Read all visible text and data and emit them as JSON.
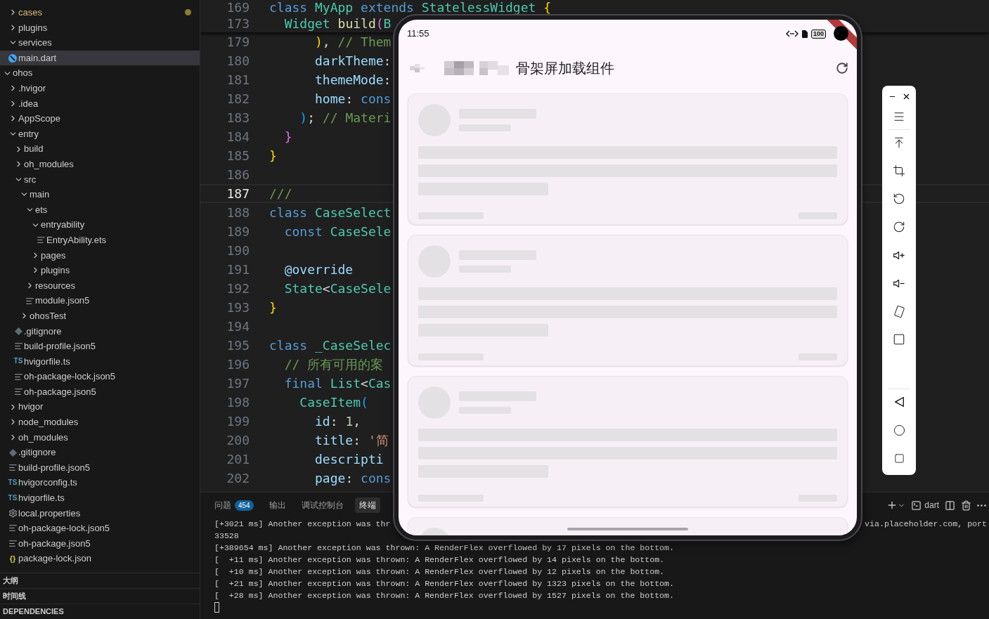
{
  "explorer": {
    "nested_items": [
      {
        "name": "cases",
        "kind": "folder",
        "expanded": false,
        "selected": false,
        "modified": true
      },
      {
        "name": "plugins",
        "kind": "folder",
        "expanded": false,
        "selected": false,
        "modified": false
      },
      {
        "name": "services",
        "kind": "folder",
        "expanded": true,
        "selected": false,
        "modified": false
      },
      {
        "name": "main.dart",
        "kind": "dart",
        "selected": true,
        "modified": false
      }
    ],
    "items": [
      {
        "name": "ohos",
        "kind": "folder",
        "expanded": true,
        "selected": false,
        "modified": false,
        "children": [
          {
            "name": ".hvigor",
            "kind": "folder",
            "expanded": false,
            "selected": false,
            "modified": false
          },
          {
            "name": ".idea",
            "kind": "folder",
            "expanded": false,
            "selected": false,
            "modified": false
          },
          {
            "name": "AppScope",
            "kind": "folder",
            "expanded": false,
            "selected": false,
            "modified": false
          },
          {
            "name": "entry",
            "kind": "folder",
            "expanded": true,
            "selected": false,
            "modified": false,
            "children": [
              {
                "name": "build",
                "kind": "folder",
                "expanded": false,
                "selected": false,
                "modified": false
              },
              {
                "name": "oh_modules",
                "kind": "folder",
                "expanded": false,
                "selected": false,
                "modified": false
              },
              {
                "name": "src",
                "kind": "folder",
                "expanded": true,
                "selected": false,
                "modified": false,
                "children": [
                  {
                    "name": "main",
                    "kind": "folder",
                    "expanded": true,
                    "selected": false,
                    "modified": false,
                    "children": [
                      {
                        "name": "ets",
                        "kind": "folder",
                        "expanded": true,
                        "selected": false,
                        "modified": false,
                        "children": [
                          {
                            "name": "entryability",
                            "kind": "folder",
                            "expanded": true,
                            "selected": false,
                            "modified": false,
                            "children": [
                              {
                                "name": "EntryAbility.ets",
                                "kind": "text",
                                "selected": false,
                                "modified": false
                              }
                            ]
                          },
                          {
                            "name": "pages",
                            "kind": "folder",
                            "expanded": false,
                            "selected": false,
                            "modified": false
                          },
                          {
                            "name": "plugins",
                            "kind": "folder",
                            "expanded": false,
                            "selected": false,
                            "modified": false
                          }
                        ]
                      },
                      {
                        "name": "resources",
                        "kind": "folder",
                        "expanded": false,
                        "selected": false,
                        "modified": false
                      },
                      {
                        "name": "module.json5",
                        "kind": "text",
                        "selected": false,
                        "modified": false
                      }
                    ]
                  },
                  {
                    "name": "ohosTest",
                    "kind": "folder",
                    "expanded": false,
                    "selected": false,
                    "modified": false
                  }
                ]
              },
              {
                "name": ".gitignore",
                "kind": "git",
                "selected": false,
                "modified": false
              },
              {
                "name": "build-profile.json5",
                "kind": "text",
                "selected": false,
                "modified": false
              },
              {
                "name": "hvigorfile.ts",
                "kind": "ts",
                "icon_text": "TS",
                "selected": false,
                "modified": false
              },
              {
                "name": "oh-package-lock.json5",
                "kind": "text",
                "selected": false,
                "modified": false
              },
              {
                "name": "oh-package.json5",
                "kind": "text",
                "selected": false,
                "modified": false
              }
            ]
          },
          {
            "name": "hvigor",
            "kind": "folder",
            "expanded": false,
            "selected": false,
            "modified": false
          },
          {
            "name": "node_modules",
            "kind": "folder",
            "expanded": false,
            "selected": false,
            "modified": false
          },
          {
            "name": "oh_modules",
            "kind": "folder",
            "expanded": false,
            "selected": false,
            "modified": false
          },
          {
            "name": ".gitignore",
            "kind": "git",
            "selected": false,
            "modified": false
          },
          {
            "name": "build-profile.json5",
            "kind": "text",
            "selected": false,
            "modified": false
          },
          {
            "name": "hvigorconfig.ts",
            "kind": "ts",
            "icon_text": "TS",
            "selected": false,
            "modified": false
          },
          {
            "name": "hvigorfile.ts",
            "kind": "ts",
            "icon_text": "TS",
            "selected": false,
            "modified": false
          },
          {
            "name": "local.properties",
            "kind": "gear",
            "selected": false,
            "modified": false
          },
          {
            "name": "oh-package-lock.json5",
            "kind": "text",
            "selected": false,
            "modified": false
          },
          {
            "name": "oh-package.json5",
            "kind": "text",
            "selected": false,
            "modified": false
          },
          {
            "name": "package-lock.json",
            "kind": "braces",
            "icon_text": "{}",
            "selected": false,
            "modified": false
          }
        ]
      }
    ]
  },
  "sections": [
    {
      "label": "大纲"
    },
    {
      "label": "时间线"
    },
    {
      "label": "DEPENDENCIES"
    }
  ],
  "editor": {
    "sticky_lines": [
      {
        "number": "169",
        "current": false,
        "tokens": [
          {
            "t": "class",
            "kind": "keyword"
          },
          {
            "t": " MyApp",
            "kind": "type"
          },
          {
            "t": " extends",
            "kind": "keyword"
          },
          {
            "t": " StatelessWidget",
            "kind": "type"
          },
          {
            "t": " {",
            "kind": "bracket1"
          }
        ]
      },
      {
        "number": "173",
        "current": false,
        "tokens": [
          {
            "t": "  Widget",
            "kind": "type"
          },
          {
            "t": " build",
            "kind": "function"
          },
          {
            "t": "(",
            "kind": "bracket2"
          },
          {
            "t": "B",
            "kind": "type"
          }
        ]
      }
    ],
    "lines": [
      {
        "number": "179",
        "current": false,
        "tokens": [
          {
            "t": "      )",
            "kind": "bracket1"
          },
          {
            "t": ", ",
            "kind": "plain"
          },
          {
            "t": "// Them",
            "kind": "comment"
          }
        ]
      },
      {
        "number": "180",
        "current": false,
        "tokens": [
          {
            "t": "      darkTheme",
            "kind": "variable"
          },
          {
            "t": ":",
            "kind": "plain"
          }
        ]
      },
      {
        "number": "181",
        "current": false,
        "tokens": [
          {
            "t": "      themeMode",
            "kind": "variable"
          },
          {
            "t": ":",
            "kind": "plain"
          }
        ]
      },
      {
        "number": "182",
        "current": false,
        "tokens": [
          {
            "t": "      home",
            "kind": "variable"
          },
          {
            "t": ": ",
            "kind": "plain"
          },
          {
            "t": "cons",
            "kind": "keyword"
          }
        ]
      },
      {
        "number": "183",
        "current": false,
        "tokens": [
          {
            "t": "    )",
            "kind": "bracket3"
          },
          {
            "t": "; ",
            "kind": "plain"
          },
          {
            "t": "// Materi",
            "kind": "comment"
          }
        ]
      },
      {
        "number": "184",
        "current": false,
        "tokens": [
          {
            "t": "  }",
            "kind": "bracket2"
          }
        ]
      },
      {
        "number": "185",
        "current": false,
        "tokens": [
          {
            "t": "}",
            "kind": "bracket1"
          }
        ]
      },
      {
        "number": "186",
        "current": false
      },
      {
        "number": "187",
        "current": true,
        "tokens": [
          {
            "t": "///",
            "kind": "comment"
          }
        ]
      },
      {
        "number": "188",
        "current": false,
        "tokens": [
          {
            "t": "class",
            "kind": "keyword"
          },
          {
            "t": " CaseSelect",
            "kind": "type"
          }
        ]
      },
      {
        "number": "189",
        "current": false,
        "tokens": [
          {
            "t": "  const",
            "kind": "keyword"
          },
          {
            "t": " CaseSele",
            "kind": "type"
          }
        ]
      },
      {
        "number": "190",
        "current": false
      },
      {
        "number": "191",
        "current": false,
        "tokens": [
          {
            "t": "  @override",
            "kind": "variable"
          }
        ]
      },
      {
        "number": "192",
        "current": false,
        "tokens": [
          {
            "t": "  State",
            "kind": "type"
          },
          {
            "t": "<",
            "kind": "plain"
          },
          {
            "t": "CaseSele",
            "kind": "type"
          }
        ]
      },
      {
        "number": "193",
        "current": false,
        "tokens": [
          {
            "t": "}",
            "kind": "bracket1"
          }
        ]
      },
      {
        "number": "194",
        "current": false
      },
      {
        "number": "195",
        "current": false,
        "tokens": [
          {
            "t": "class",
            "kind": "keyword"
          },
          {
            "t": " _CaseSelec",
            "kind": "type"
          }
        ]
      },
      {
        "number": "196",
        "current": false,
        "tokens": [
          {
            "t": "  // 所有可用的案",
            "kind": "comment"
          }
        ]
      },
      {
        "number": "197",
        "current": false,
        "tokens": [
          {
            "t": "  final",
            "kind": "keyword"
          },
          {
            "t": " List",
            "kind": "type"
          },
          {
            "t": "<",
            "kind": "plain"
          },
          {
            "t": "Cas",
            "kind": "type"
          }
        ]
      },
      {
        "number": "198",
        "current": false,
        "tokens": [
          {
            "t": "    CaseItem",
            "kind": "type"
          },
          {
            "t": "(",
            "kind": "bracket3"
          }
        ]
      },
      {
        "number": "199",
        "current": false,
        "tokens": [
          {
            "t": "      id",
            "kind": "variable"
          },
          {
            "t": ": ",
            "kind": "plain"
          },
          {
            "t": "1",
            "kind": "number"
          },
          {
            "t": ",",
            "kind": "plain"
          }
        ]
      },
      {
        "number": "200",
        "current": false,
        "tokens": [
          {
            "t": "      title",
            "kind": "variable"
          },
          {
            "t": ": ",
            "kind": "plain"
          },
          {
            "t": "'简",
            "kind": "string"
          }
        ]
      },
      {
        "number": "201",
        "current": false,
        "tokens": [
          {
            "t": "      descripti",
            "kind": "variable"
          }
        ]
      },
      {
        "number": "202",
        "current": false,
        "tokens": [
          {
            "t": "      page",
            "kind": "variable"
          },
          {
            "t": ": ",
            "kind": "plain"
          },
          {
            "t": "cons",
            "kind": "keyword"
          }
        ]
      }
    ]
  },
  "panel": {
    "tabs": [
      {
        "label": "问题",
        "badge": "454",
        "selected": false
      },
      {
        "label": "输出",
        "selected": false
      },
      {
        "label": "调试控制台",
        "selected": false
      },
      {
        "label": "终端",
        "selected": true
      }
    ],
    "terminal_name": "dart",
    "terminal_lines": [
      {
        "text": "[+3021 ms] Another exception was thr",
        "right": "via.placeholder.com, port"
      },
      {
        "text": "33528"
      },
      {
        "text": "[+389654 ms] Another exception was thrown: A RenderFlex overflowed by 17 pixels on the bottom."
      },
      {
        "text": "[  +11 ms] Another exception was thrown: A RenderFlex overflowed by 14 pixels on the bottom."
      },
      {
        "text": "[  +10 ms] Another exception was thrown: A RenderFlex overflowed by 12 pixels on the bottom."
      },
      {
        "text": "[  +21 ms] Another exception was thrown: A RenderFlex overflowed by 1323 pixels on the bottom."
      },
      {
        "text": "[  +28 ms] Another exception was thrown: A RenderFlex overflowed by 1527 pixels on the bottom."
      }
    ]
  },
  "emulator": {
    "time": "11:55",
    "battery": "100",
    "title": "骨架屏加载组件",
    "cards": [
      {
        "kind": "skeleton"
      },
      {
        "kind": "skeleton"
      },
      {
        "kind": "skeleton"
      },
      {
        "kind": "skeleton"
      }
    ]
  }
}
